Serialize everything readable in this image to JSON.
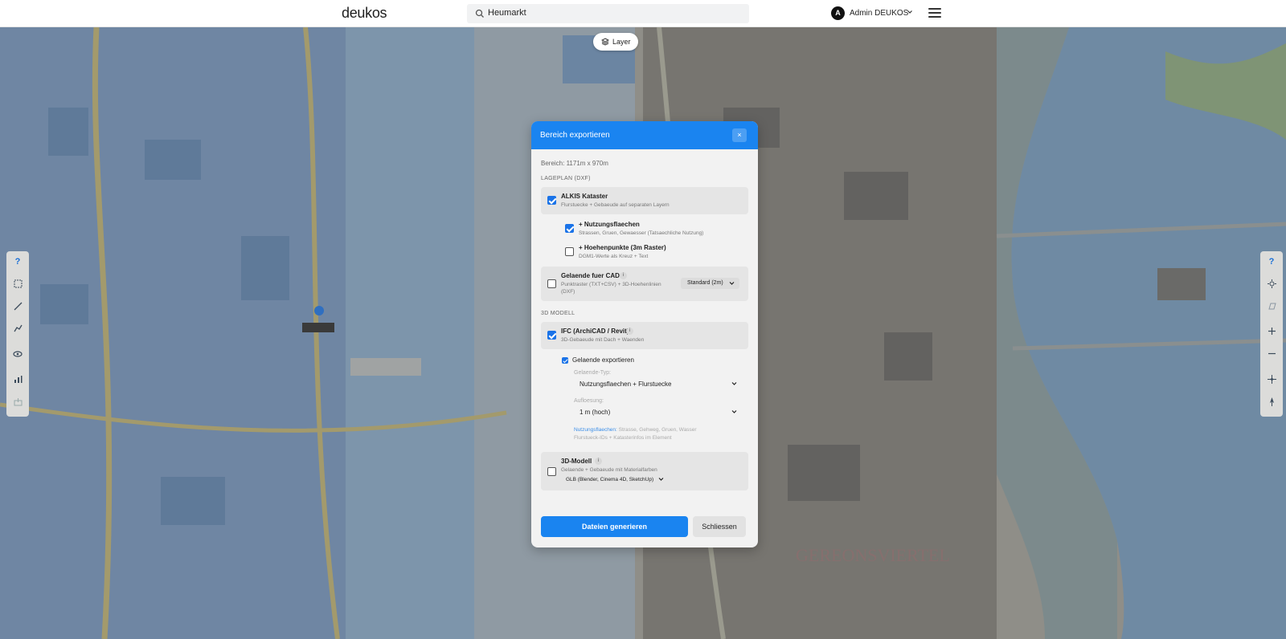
{
  "header": {
    "logo": "deukos",
    "search_value": "Heumarkt",
    "avatar_initial": "A",
    "username": "Admin DEUKOS"
  },
  "map": {
    "layer_button": "Layer",
    "left_toolbar_help": "?",
    "right_toolbar_help": "?"
  },
  "modal": {
    "title": "Bereich exportieren",
    "close": "×",
    "bereich": "Bereich: 1171m x 970m",
    "section_lageplan": "LAGEPLAN (DXF)",
    "alkis": {
      "title": "ALKIS Kataster",
      "subtitle": "Flurstuecke + Gebaeude auf separaten Layern",
      "checked": true
    },
    "nutzung": {
      "title": "+ Nutzungsflaechen",
      "subtitle": "Strassen, Gruen, Gewaesser (Tatsaechliche Nutzung)",
      "checked": true
    },
    "hoehen": {
      "title": "+ Hoehenpunkte (3m Raster)",
      "subtitle": "DGM1-Werte als Kreuz + Text",
      "checked": false
    },
    "gelaende_cad": {
      "title": "Gelaende fuer CAD",
      "info": "i",
      "subtitle_1": "Punktraster (TXT+CSV) + 3D-Hoehenlinien",
      "subtitle_2": "(DXF)",
      "select": "Standard (2m)",
      "checked": false
    },
    "section_3d": "3D MODELL",
    "ifc": {
      "title": "IFC (ArchiCAD / Revit)",
      "info": "i",
      "subtitle": "3D-Gebaeude mit Dach + Waenden",
      "checked": true
    },
    "gelaende_export": {
      "label": "Gelaende exportieren",
      "checked": true
    },
    "gelaende_typ": {
      "label": "Gelaende-Typ:",
      "value": "Nutzungsflaechen + Flurstuecke"
    },
    "aufloesung": {
      "label": "Aufloesung:",
      "value": "1 m (hoch)"
    },
    "hint": {
      "blue": "Nutzungsflaechen:",
      "line1": " Strasse, Gehweg, Gruen, Wasser",
      "line2": "Flurstueck-IDs + Katasterinfos im Element"
    },
    "modell3d": {
      "title": "3D-Modell",
      "info": "i",
      "subtitle": "Gelaende + Gebaeude mit Materialfarben",
      "format": "GLB (Blender, Cinema 4D, SketchUp)",
      "checked": false
    },
    "generate_button": "Dateien generieren",
    "close_button": "Schliessen"
  },
  "colors": {
    "accent": "#1a84f0",
    "checkbox": "#1a73e8",
    "hint_link": "#3b8ee8"
  },
  "icons": {
    "search": "search-icon",
    "layers": "layers-icon",
    "menu": "hamburger-icon",
    "chevron": "chevron-down-icon"
  }
}
